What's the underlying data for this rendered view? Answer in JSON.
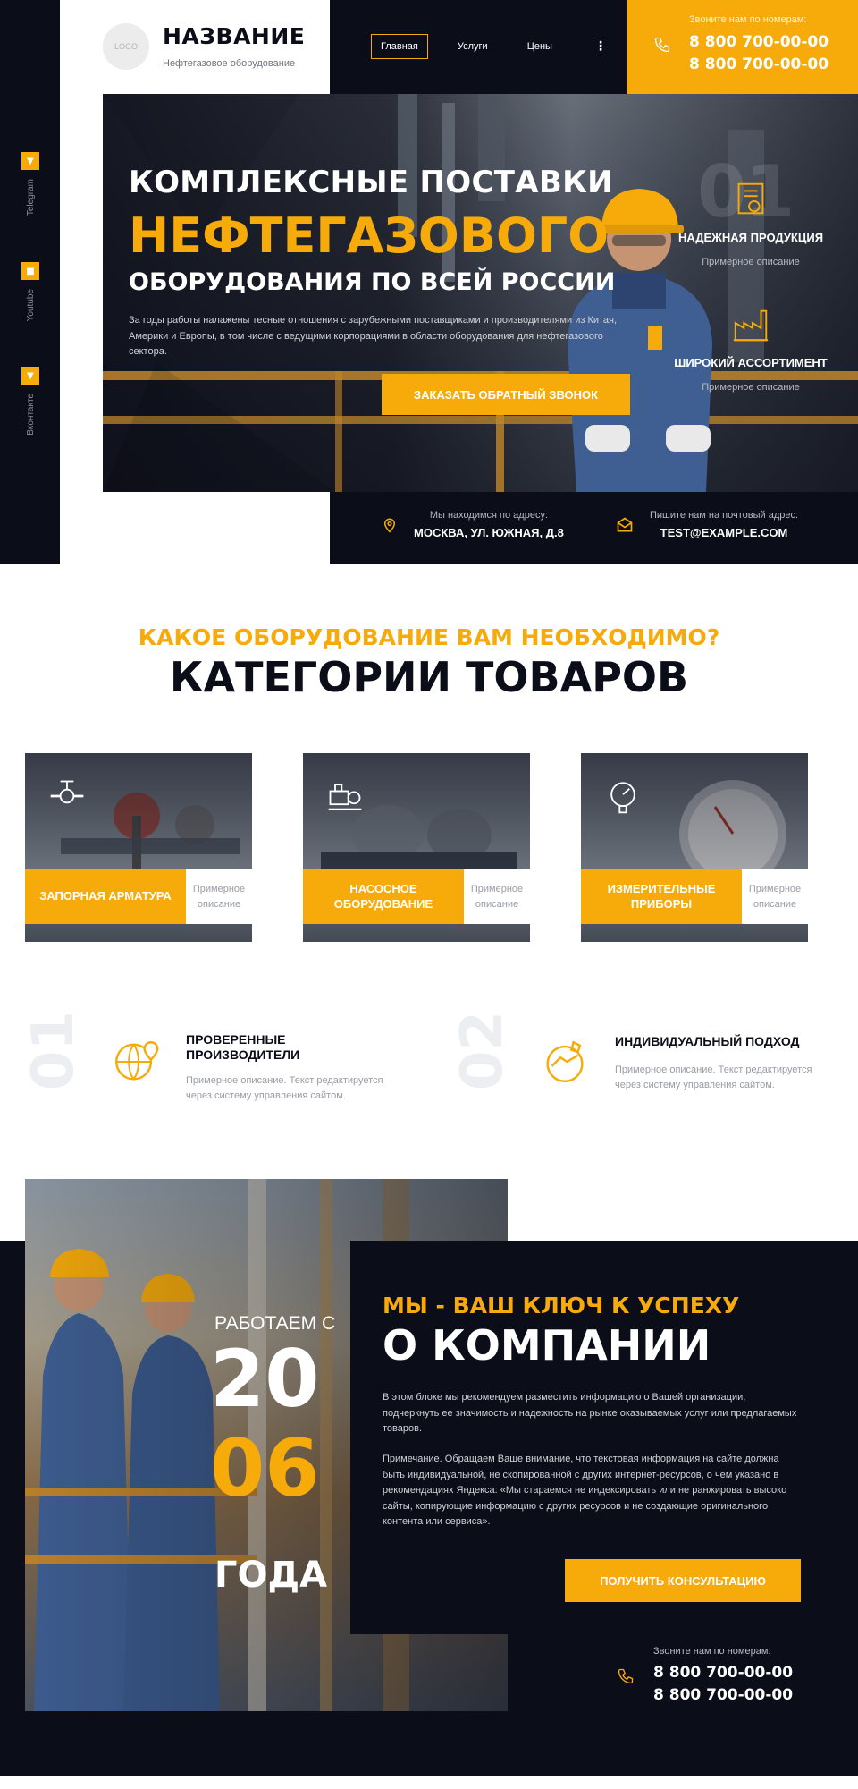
{
  "header": {
    "logo_text": "LOGO",
    "brand_name": "НАЗВАНИЕ",
    "brand_sub": "Нефтегазовое оборудование",
    "nav": [
      {
        "label": "Главная",
        "active": true
      },
      {
        "label": "Услуги",
        "active": false
      },
      {
        "label": "Цены",
        "active": false
      }
    ],
    "phone_title": "Звоните нам по номерам:",
    "phones": [
      "8 800 700-00-00",
      "8 800 700-00-00"
    ]
  },
  "social": [
    {
      "label": "Telegram",
      "icon": "telegram-icon"
    },
    {
      "label": "Youtube",
      "icon": "youtube-icon"
    },
    {
      "label": "Вконтакте",
      "icon": "vk-icon"
    }
  ],
  "hero": {
    "line1": "КОМПЛЕКСНЫЕ ПОСТАВКИ",
    "line2": "НЕФТЕГАЗОВОГО",
    "line3": "ОБОРУДОВАНИЯ ПО ВСЕЙ РОССИИ",
    "text": "За годы работы налажены тесные отношения с зарубежными поставщиками и производителями из Китая, Америки и Европы, в том числе с ведущими корпорациями в области оборудования для нефтегазового сектора.",
    "cta": "ЗАКАЗАТЬ ОБРАТНЫЙ ЗВОНОК",
    "big_number": "01",
    "features": [
      {
        "title": "НАДЕЖНАЯ ПРОДУКЦИЯ",
        "desc": "Примерное описание",
        "icon": "certificate-icon"
      },
      {
        "title": "ШИРОКИЙ АССОРТИМЕНТ",
        "desc": "Примерное описание",
        "icon": "factory-icon"
      }
    ]
  },
  "info": {
    "address_label": "Мы находимся по адресу:",
    "address_value": "МОСКВА, УЛ. ЮЖНАЯ, Д.8",
    "email_label": "Пишите нам на почтовый адрес:",
    "email_value": "TEST@EXAMPLE.COM"
  },
  "categories": {
    "subtitle": "КАКОЕ ОБОРУДОВАНИЕ ВАМ НЕОБХОДИМО?",
    "title": "КАТЕГОРИИ ТОВАРОВ",
    "items": [
      {
        "name": "ЗАПОРНАЯ АРМАТУРА",
        "desc": "Примерное описание",
        "icon": "valve-icon"
      },
      {
        "name": "НАСОСНОЕ ОБОРУДОВАНИЕ",
        "desc": "Примерное описание",
        "icon": "pump-icon"
      },
      {
        "name": "ИЗМЕРИТЕЛЬНЫЕ ПРИБОРЫ",
        "desc": "Примерное описание",
        "icon": "gauge-icon"
      }
    ]
  },
  "advantages": [
    {
      "num": "01",
      "title": "ПРОВЕРЕННЫЕ ПРОИЗВОДИТЕЛИ",
      "desc": "Примерное описание. Текст редактируется через систему управления сайтом.",
      "icon": "globe-pin-icon"
    },
    {
      "num": "02",
      "title": "ИНДИВИДУАЛЬНЫЙ ПОДХОД",
      "desc": "Примерное описание. Текст редактируется через систему управления сайтом.",
      "icon": "handshake-icon"
    }
  ],
  "about": {
    "work_label": "РАБОТАЕМ С",
    "year_part1": "20",
    "year_part2": "06",
    "year_label": "ГОДА",
    "subtitle": "МЫ - ВАШ КЛЮЧ К УСПЕХУ",
    "title": "О КОМПАНИИ",
    "p1": "В этом блоке мы рекомендуем разместить информацию о Вашей организации, подчеркнуть ее значимость и надежность на рынке оказываемых услуг или предлагаемых товаров.",
    "p2": "Примечание. Обращаем Ваше внимание, что текстовая информация на сайте должна быть индивидуальной, не скопированной с других интернет-ресурсов, о чем указано в рекомендациях Яндекса: «Мы стараемся не индексировать или не ранжировать высоко сайты, копирующие информацию с других ресурсов и не создающие оригинального контента или сервиса».",
    "cta": "ПОЛУЧИТЬ КОНСУЛЬТАЦИЮ",
    "phone_title": "Звоните нам по номерам:",
    "phones": [
      "8 800 700-00-00",
      "8 800 700-00-00"
    ]
  },
  "colors": {
    "accent": "#f7ab0a",
    "dark": "#0b0d18"
  }
}
